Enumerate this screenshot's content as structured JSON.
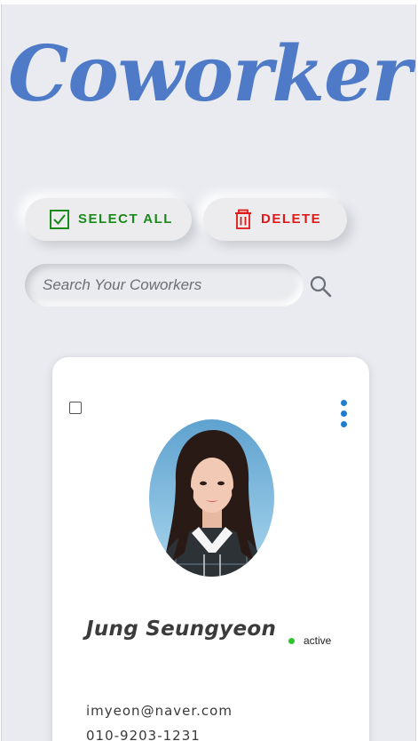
{
  "app": {
    "title": "Coworker",
    "brand_color": "#4f7ac8"
  },
  "toolbar": {
    "select_all_label": "SELECT ALL",
    "select_all_icon": "checkbox-checked-icon",
    "select_all_color": "#1a8a1a",
    "delete_label": "DELETE",
    "delete_icon": "trash-icon",
    "delete_color": "#e01818"
  },
  "search": {
    "placeholder": "Search Your Coworkers",
    "value": "",
    "icon": "search-icon"
  },
  "coworkers": [
    {
      "name": "Jung Seungyeon",
      "status": "active",
      "status_color": "#31c431",
      "email": "imyeon@naver.com",
      "phone": "010-9203-1231",
      "selected": false,
      "menu_icon": "kebab-menu-icon"
    }
  ]
}
